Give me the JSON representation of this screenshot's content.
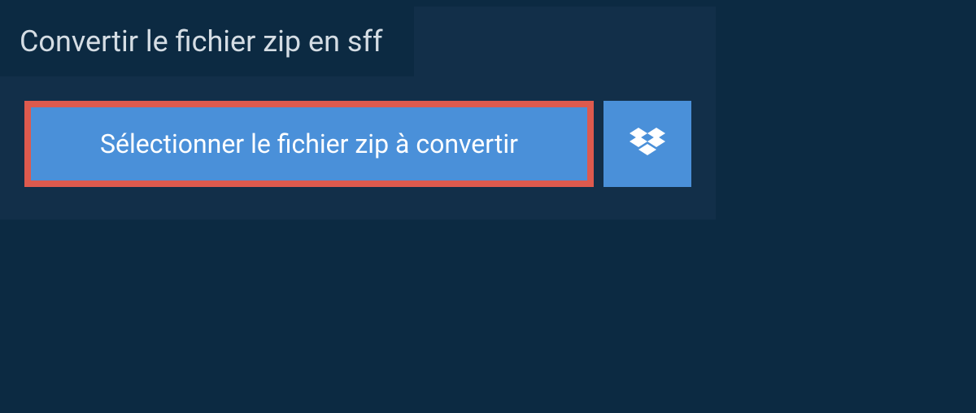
{
  "header": {
    "title": "Convertir le fichier zip en sff"
  },
  "buttons": {
    "select_file_label": "Sélectionner le fichier zip à convertir"
  },
  "colors": {
    "background_dark": "#0c2a42",
    "background_panel": "#122f49",
    "button_primary": "#4a90d9",
    "highlight_border": "#dd5a4e",
    "text_light": "#d5dde4",
    "text_white": "#ffffff"
  }
}
